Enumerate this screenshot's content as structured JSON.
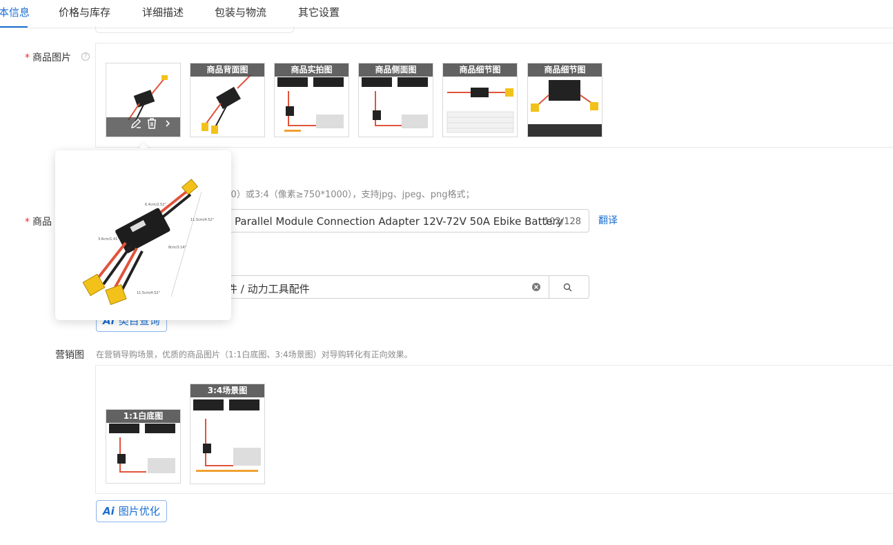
{
  "tabs": [
    {
      "label": "本信息",
      "active": true
    },
    {
      "label": "价格与库存"
    },
    {
      "label": "详细描述"
    },
    {
      "label": "包装与物流"
    },
    {
      "label": "其它设置"
    }
  ],
  "product_images": {
    "label": "商品图片",
    "required_mark": "*",
    "help_icon": "question-circle-icon",
    "thumbnails": [
      {
        "caption": ""
      },
      {
        "caption": "商品背面图"
      },
      {
        "caption": "商品实拍图"
      },
      {
        "caption": "商品侧面图"
      },
      {
        "caption": "商品细节图"
      },
      {
        "caption": "商品细节图"
      }
    ],
    "hint": "800）或3:4（像素≥750*1000），支持jpg、jpeg、png格式；"
  },
  "product_title": {
    "label": "商品",
    "required_mark": "*",
    "value": "Parallel Module Connection Adapter 12V-72V 50A Ebike Battery",
    "counter": "102/128",
    "translate_link": "翻译"
  },
  "category": {
    "value": "件 / 动力工具配件",
    "clear_icon": "clear-circle-icon",
    "search_icon": "search-icon"
  },
  "category_ai_button": {
    "ai": "Ai",
    "label": "类目查询"
  },
  "popup_labels": [
    "6.4cm/2.52\"",
    "11.5cm/4.52\"",
    "3.6cm/1.41\"",
    "8cm/3.14\"",
    "11.5cm/4.52\""
  ],
  "marketing": {
    "label": "营销图",
    "hint": "在营销导购场景，优质的商品图片（1:1白底图、3:4场景图）对导购转化有正向效果。",
    "thumbnails": [
      {
        "caption": "1:1白底图"
      },
      {
        "caption": "3:4场景图"
      }
    ],
    "ai_button": {
      "ai": "Ai",
      "label": "图片优化"
    }
  },
  "colors": {
    "accent": "#1a6fd1",
    "required": "#f5222d"
  }
}
